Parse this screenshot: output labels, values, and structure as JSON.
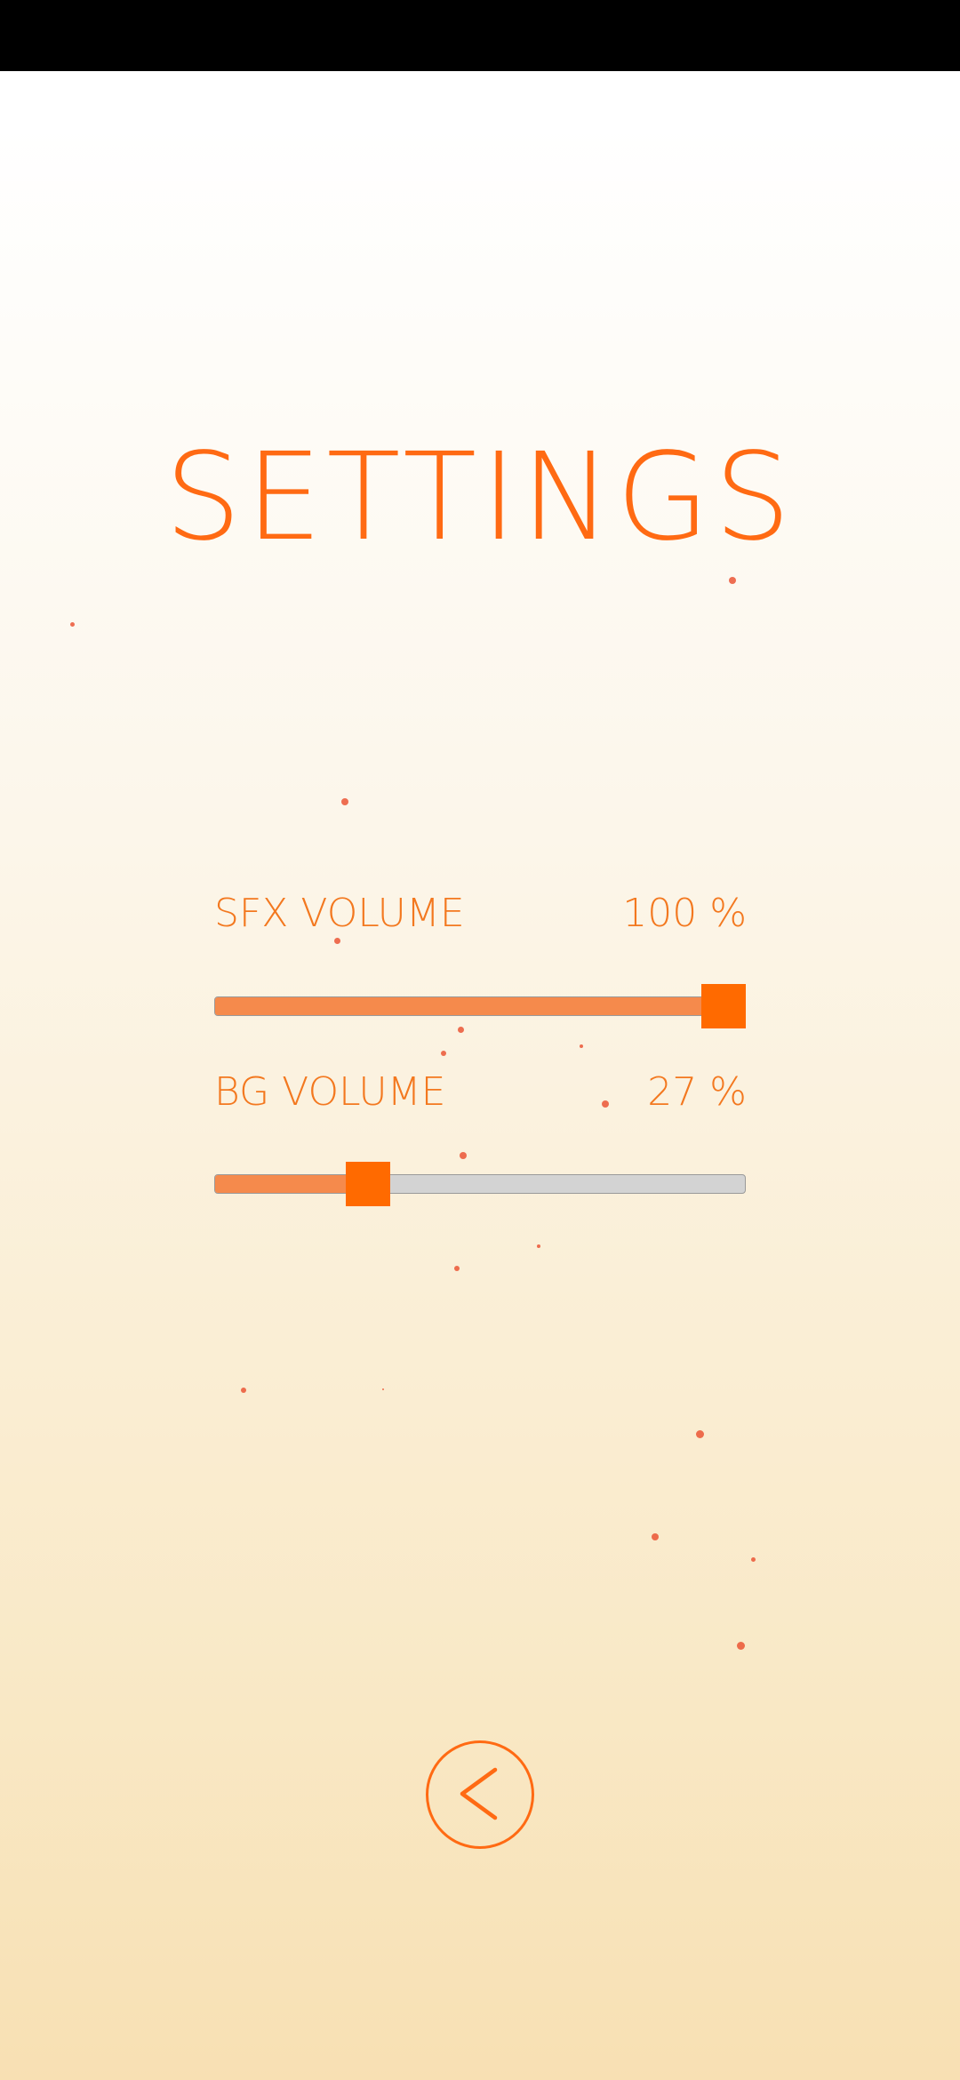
{
  "title": "SETTINGS",
  "sfx": {
    "label": "SFX VOLUME",
    "value_text": "100 %",
    "level": 1.0
  },
  "bg": {
    "label": "BG VOLUME",
    "value_text": "27 %",
    "level": 0.27
  },
  "back_button": {
    "icon": "chevron-left-icon"
  },
  "colors": {
    "accent": "#ff6a13",
    "slider_fill": "#f58a4c",
    "slider_track": "#d3d3d3",
    "particle": "#ea4b2a"
  }
}
